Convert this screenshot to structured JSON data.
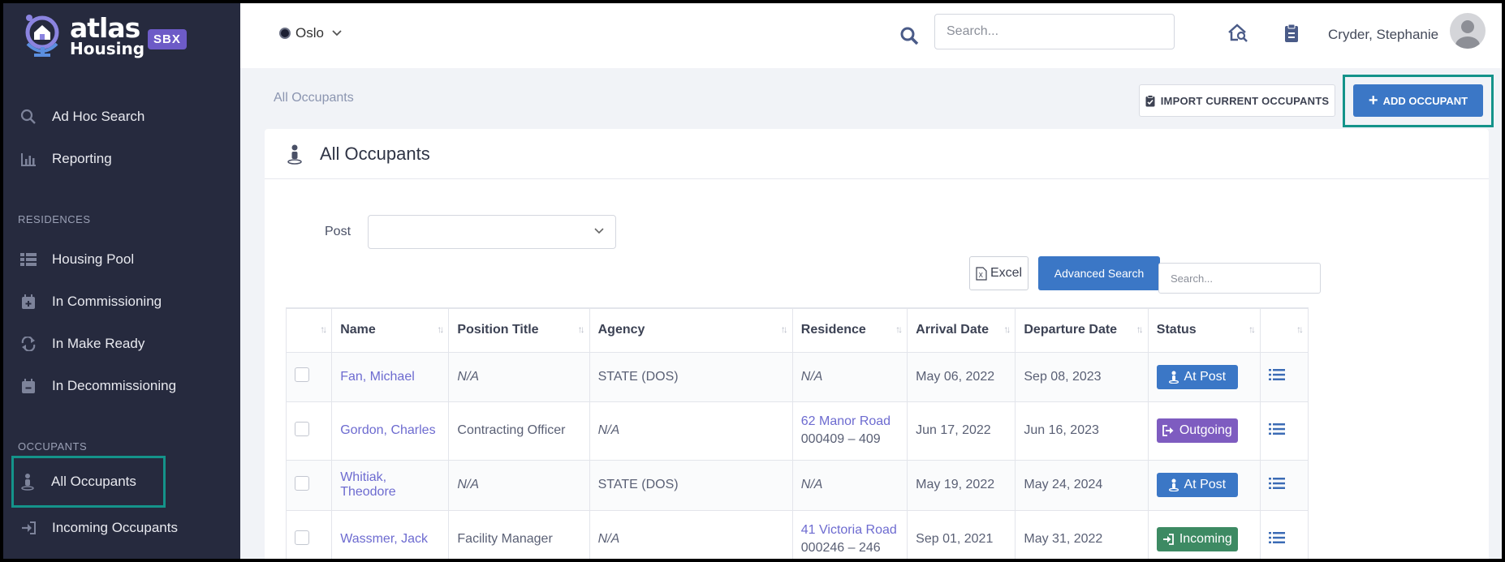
{
  "app": {
    "logo_line1": "atlas",
    "logo_line2": "Housing",
    "env_badge": "SBX"
  },
  "sidebar": {
    "items_top": [
      {
        "label": "Ad Hoc Search",
        "icon": "search-icon"
      },
      {
        "label": "Reporting",
        "icon": "bar-chart-icon"
      }
    ],
    "section_residences": "RESIDENCES",
    "items_residences": [
      {
        "label": "Housing Pool",
        "icon": "list-icon"
      },
      {
        "label": "In Commissioning",
        "icon": "calendar-plus-icon"
      },
      {
        "label": "In Make Ready",
        "icon": "refresh-icon"
      },
      {
        "label": "In Decommissioning",
        "icon": "calendar-minus-icon"
      }
    ],
    "section_occupants": "OCCUPANTS",
    "items_occupants": [
      {
        "label": "All Occupants",
        "icon": "person-pin-icon",
        "active": true
      },
      {
        "label": "Incoming Occupants",
        "icon": "sign-in-icon"
      }
    ]
  },
  "topbar": {
    "location": "Oslo",
    "search_placeholder": "Search...",
    "user_name": "Cryder, Stephanie"
  },
  "page": {
    "breadcrumb": "All Occupants",
    "import_button": "IMPORT CURRENT OCCUPANTS",
    "add_button": "ADD OCCUPANT",
    "card_title": "All Occupants",
    "post_label": "Post",
    "post_value": "",
    "excel_button": "Excel",
    "advanced_search_button": "Advanced Search",
    "table_search_placeholder": "Search..."
  },
  "table": {
    "columns": [
      "Name",
      "Position Title",
      "Agency",
      "Residence",
      "Arrival Date",
      "Departure Date",
      "Status"
    ],
    "rows": [
      {
        "name": "Fan, Michael",
        "position": "N/A",
        "agency": "STATE (DOS)",
        "residence": "N/A",
        "residence_sub": "",
        "arrival": "May 06, 2022",
        "departure": "Sep 08, 2023",
        "status": "At Post"
      },
      {
        "name": "Gordon, Charles",
        "position": "Contracting Officer",
        "agency": "N/A",
        "residence": "62 Manor Road",
        "residence_sub": "000409 – 409",
        "arrival": "Jun 17, 2022",
        "departure": "Jun 16, 2023",
        "status": "Outgoing"
      },
      {
        "name": "Whitiak, Theodore",
        "position": "N/A",
        "agency": "STATE (DOS)",
        "residence": "N/A",
        "residence_sub": "",
        "arrival": "May 19, 2022",
        "departure": "May 24, 2024",
        "status": "At Post"
      },
      {
        "name": "Wassmer, Jack",
        "position": "Facility Manager",
        "agency": "N/A",
        "residence": "41 Victoria Road",
        "residence_sub": "000246 – 246",
        "arrival": "Sep 01, 2021",
        "departure": "May 31, 2022",
        "status": "Incoming"
      }
    ]
  },
  "colors": {
    "sidebar_bg": "#262a3e",
    "primary": "#3b77c6",
    "highlight": "#14938a",
    "status_at_post": "#3b77c6",
    "status_outgoing": "#7e5cc0",
    "status_incoming": "#3d8a63"
  }
}
